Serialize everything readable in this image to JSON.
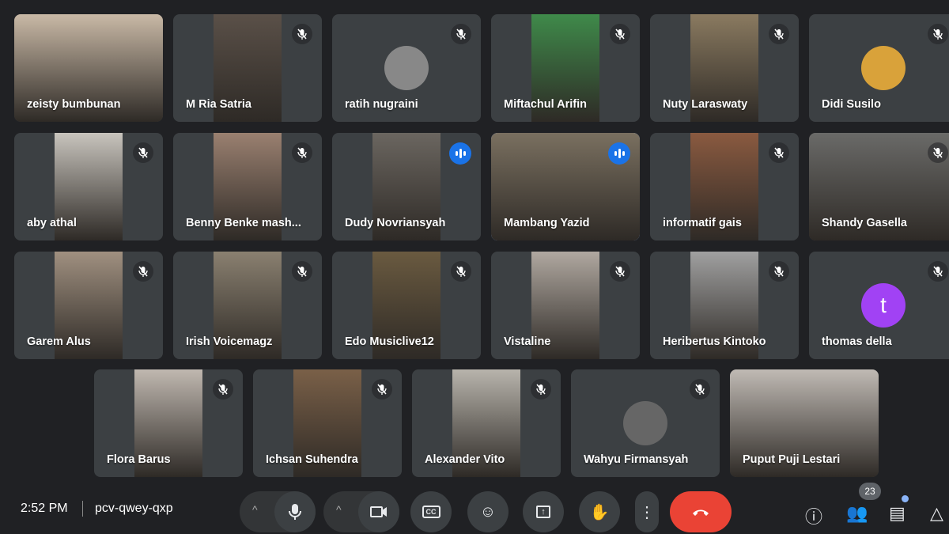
{
  "participants": [
    {
      "name": "zeisty bumbunan",
      "muted": false,
      "full": true,
      "color": "#c9b9a6"
    },
    {
      "name": "M Ria Satria",
      "muted": true,
      "color": "#5a5048"
    },
    {
      "name": "ratih nugraini",
      "muted": true,
      "avatar": "photo",
      "color": "#888"
    },
    {
      "name": "Miftachul Arifin",
      "muted": true,
      "color": "#3f8a4a"
    },
    {
      "name": "Nuty Laraswaty",
      "muted": true,
      "color": "#8a7a60"
    },
    {
      "name": "Didi Susilo",
      "muted": true,
      "avatar": "photo",
      "color": "#d9a23a"
    },
    {
      "name": "aby athal",
      "muted": true,
      "color": "#c8c4bd"
    },
    {
      "name": "Benny Benke mash...",
      "muted": true,
      "color": "#9a8070"
    },
    {
      "name": "Dudy Novriansyah",
      "muted": false,
      "speaking": false,
      "talking": true,
      "color": "#6b6660"
    },
    {
      "name": "Mambang Yazid",
      "muted": false,
      "speaking": true,
      "talking": true,
      "full": true,
      "color": "#7a7060"
    },
    {
      "name": "informatif gais",
      "muted": true,
      "color": "#8a5a40"
    },
    {
      "name": "Shandy Gasella",
      "muted": true,
      "full": true,
      "color": "#6a6a68"
    },
    {
      "name": "Garem Alus",
      "muted": true,
      "color": "#a09080"
    },
    {
      "name": "Irish Voicemagz",
      "muted": true,
      "color": "#8a8070"
    },
    {
      "name": "Edo Musiclive12",
      "muted": true,
      "color": "#6a5a40"
    },
    {
      "name": "Vistaline",
      "muted": true,
      "color": "#b0a8a0"
    },
    {
      "name": "Heribertus Kintoko",
      "muted": true,
      "color": "#a0a0a0"
    },
    {
      "name": "thomas della",
      "muted": true,
      "avatar": "letter",
      "letter": "t",
      "color": "#a142f4"
    },
    {
      "name": "Flora Barus",
      "muted": true,
      "color": "#c0b8b0"
    },
    {
      "name": "Ichsan Suhendra",
      "muted": true,
      "color": "#7a6048"
    },
    {
      "name": "Alexander Vito",
      "muted": true,
      "color": "#b8b4ac"
    },
    {
      "name": "Wahyu Firmansyah",
      "muted": true,
      "avatar": "photo",
      "color": "#666"
    },
    {
      "name": "Puput Puji Lestari",
      "muted": false,
      "full": true,
      "color": "#c0bab4"
    }
  ],
  "bottom": {
    "time": "2:52 PM",
    "meeting_code": "pcv-qwey-qxp",
    "participant_count": "23"
  },
  "icons": {
    "mic": "microphone-icon",
    "camera": "camera-icon",
    "cc": "captions-icon",
    "emoji": "emoji-icon",
    "present": "present-icon",
    "hand": "raise-hand-icon",
    "more": "more-vert-icon",
    "end": "end-call-icon",
    "info": "info-icon",
    "people": "people-icon",
    "chat": "chat-icon",
    "activities": "activities-icon"
  },
  "colors": {
    "end_call": "#ea4335",
    "speaking": "#1a73e8"
  }
}
